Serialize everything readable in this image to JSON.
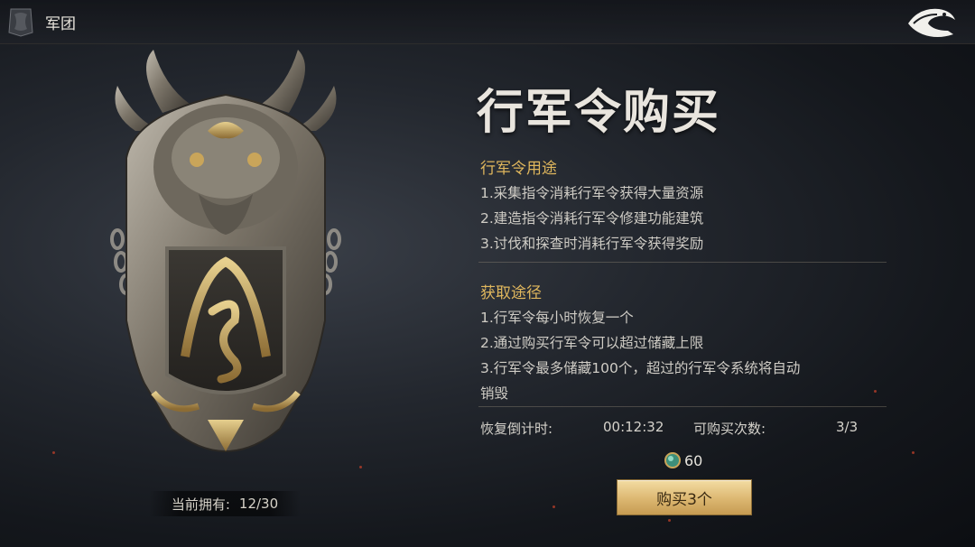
{
  "topbar": {
    "title": "军团",
    "back_icon": "dragon-back-icon"
  },
  "token": {
    "owned_label": "当前拥有:",
    "owned_value": "12/30"
  },
  "panel": {
    "title": "行军令购买",
    "usage": {
      "heading": "行军令用途",
      "items": [
        "1.采集指令消耗行军令获得大量资源",
        "2.建造指令消耗行军令修建功能建筑",
        "3.讨伐和探查时消耗行军令获得奖励"
      ]
    },
    "acquire": {
      "heading": "获取途径",
      "items": [
        "1.行军令每小时恢复一个",
        "2.通过购买行军令可以超过储藏上限",
        "3.行军令最多储藏100个，超过的行军令系统将自动",
        "销毁"
      ]
    },
    "countdown_label": "恢复倒计时:",
    "countdown_value": "00:12:32",
    "purchases_label": "可购买次数:",
    "purchases_value": "3/3",
    "cost_value": "60",
    "buy_label": "购买3个"
  },
  "colors": {
    "accent": "#e0b75d",
    "button": "#dcb771"
  }
}
